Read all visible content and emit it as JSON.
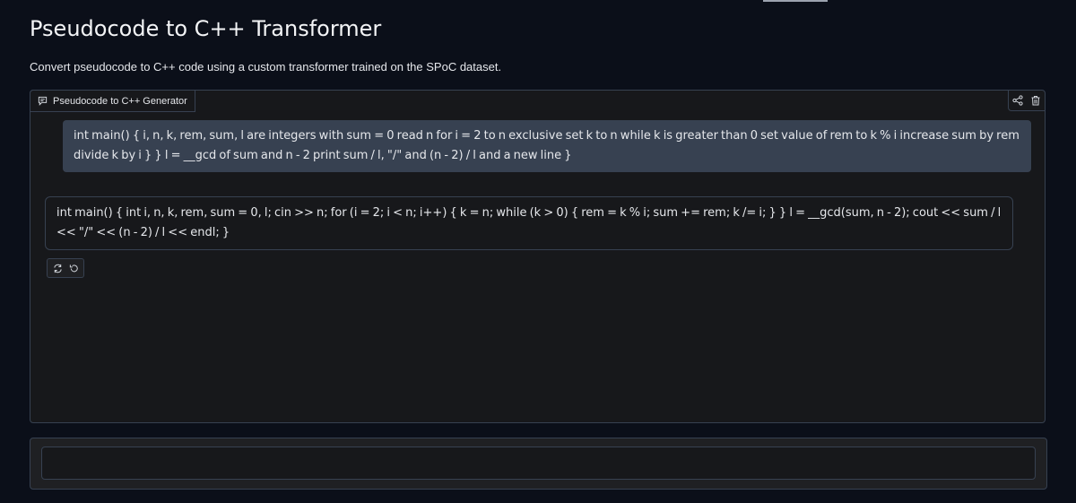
{
  "header": {
    "title": "Pseudocode to C++ Transformer",
    "description": "Convert pseudocode to C++ code using a custom transformer trained on the SPoC dataset."
  },
  "chat": {
    "label": "Pseudocode to C++ Generator",
    "label_icon": "chat-bubble-icon",
    "panel_icons": [
      "share-icon",
      "trash-icon"
    ],
    "messages": [
      {
        "role": "user",
        "text": "int main() { i, n, k, rem, sum, l are integers with sum = 0 read n for i = 2 to n exclusive set k to n while k is greater than 0 set value of rem to k % i increase sum by rem divide k by i } } l = __gcd of sum and n - 2 print sum / l, \"/\" and (n - 2) / l and a new line }"
      },
      {
        "role": "bot",
        "text": "int main() { int i, n, k, rem, sum = 0, l; cin >> n; for (i = 2; i < n; i++) { k = n; while (k > 0) { rem = k % i; sum += rem; k /= i; } } l = __gcd(sum, n - 2); cout << sum / l << \"/\" << (n - 2) / l << endl; }"
      }
    ],
    "message_action_icons": [
      "retry-icon",
      "undo-icon"
    ]
  },
  "input": {
    "value": "",
    "placeholder": ""
  },
  "colors": {
    "background": "#0b0f19",
    "panel": "#17181b",
    "border": "#374151",
    "user_bubble": "#374151",
    "text": "#e5e7eb"
  }
}
